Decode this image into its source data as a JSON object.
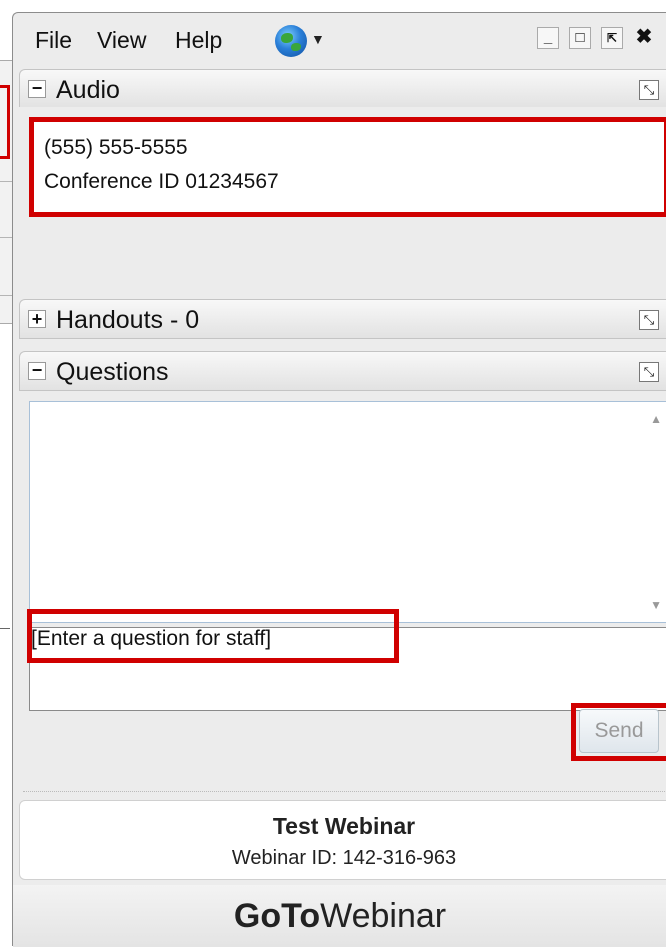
{
  "menu": {
    "items": [
      "File",
      "View",
      "Help"
    ],
    "language_icon": "globe-icon"
  },
  "window_controls": [
    "minimize-icon",
    "maximize-icon",
    "popout-icon",
    "close-icon"
  ],
  "sections": {
    "audio": {
      "title": "Audio",
      "toggle": "−",
      "phone": "(555) 555-5555",
      "conference": "Conference ID 01234567"
    },
    "handouts": {
      "title": "Handouts - 0",
      "toggle": "+"
    },
    "questions": {
      "title": "Questions",
      "toggle": "−",
      "input_text": "[Enter a question for staff]",
      "send_label": "Send"
    }
  },
  "footer": {
    "webinar_name": "Test Webinar",
    "webinar_id": "Webinar ID: 142-316-963"
  },
  "brand": {
    "part1": "GoTo",
    "part2": "Webinar"
  },
  "colors": {
    "highlight": "#d00000",
    "panel_bg": "#ececec"
  }
}
